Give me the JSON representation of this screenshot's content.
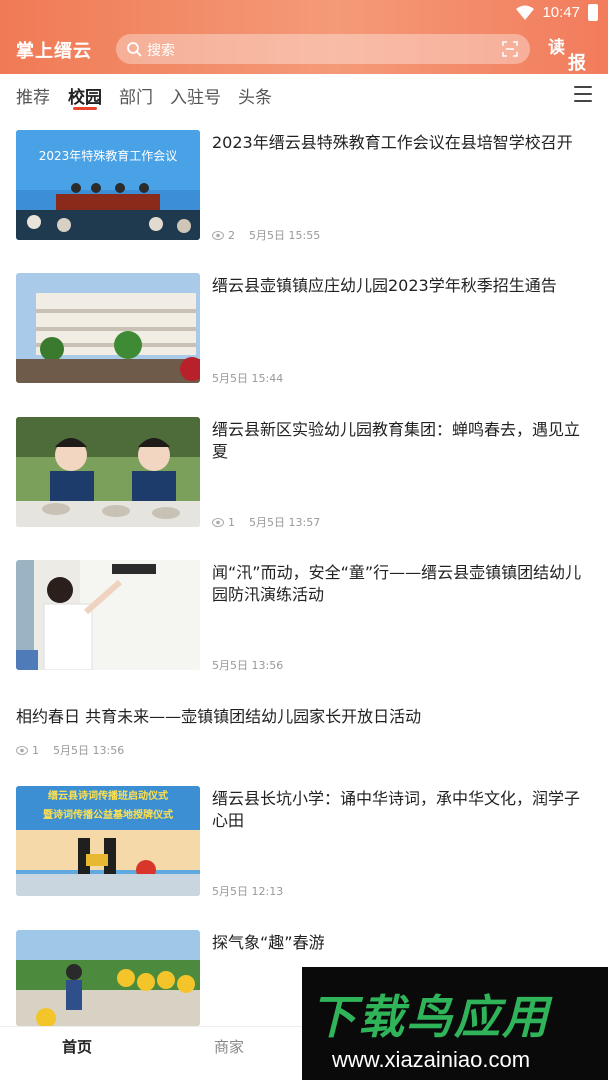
{
  "status": {
    "time": "10:47"
  },
  "header": {
    "app_title": "掌上缙云",
    "search_placeholder": "搜索",
    "read_logo_1": "读",
    "read_logo_2": "报"
  },
  "tabs": [
    {
      "label": "推荐"
    },
    {
      "label": "校园"
    },
    {
      "label": "部门"
    },
    {
      "label": "入驻号"
    },
    {
      "label": "头条"
    }
  ],
  "active_tab": "校园",
  "news": [
    {
      "title": "2023年缙云县特殊教育工作会议在县培智学校召开",
      "views": "2",
      "time": "5月5日 15:55",
      "thumb_text": "2023年特殊教育工作会议"
    },
    {
      "title": "缙云县壶镇镇应庄幼儿园2023学年秋季招生通告",
      "views": "",
      "time": "5月5日 15:44"
    },
    {
      "title": "缙云县新区实验幼儿园教育集团：蝉鸣春去，遇见立夏",
      "views": "1",
      "time": "5月5日 13:57"
    },
    {
      "title": "闻“汛”而动，安全“童”行——缙云县壶镇镇团结幼儿园防汛演练活动",
      "views": "",
      "time": "5月5日 13:56"
    },
    {
      "title": "相约春日 共育未来——壶镇镇团结幼儿园家长开放日活动",
      "views": "1",
      "time": "5月5日 13:56"
    },
    {
      "title": "缙云县长坑小学：诵中华诗词，承中华文化，润学子心田",
      "views": "",
      "time": "5月5日 12:13",
      "thumb_text_1": "缙云县诗词传播班启动仪式",
      "thumb_text_2": "暨诗词传播公益基地授牌仪式"
    },
    {
      "title": "探气象“趣”春游",
      "views": "",
      "time": ""
    }
  ],
  "bottom_nav": {
    "home": "首页",
    "shop": "商家"
  },
  "watermark": {
    "main": "下载鸟应用",
    "url": "www.xiazainiao.com"
  },
  "colors": {
    "accent": "#e8452c",
    "header": "#f07a55",
    "watermark_green": "#2fb45a"
  }
}
